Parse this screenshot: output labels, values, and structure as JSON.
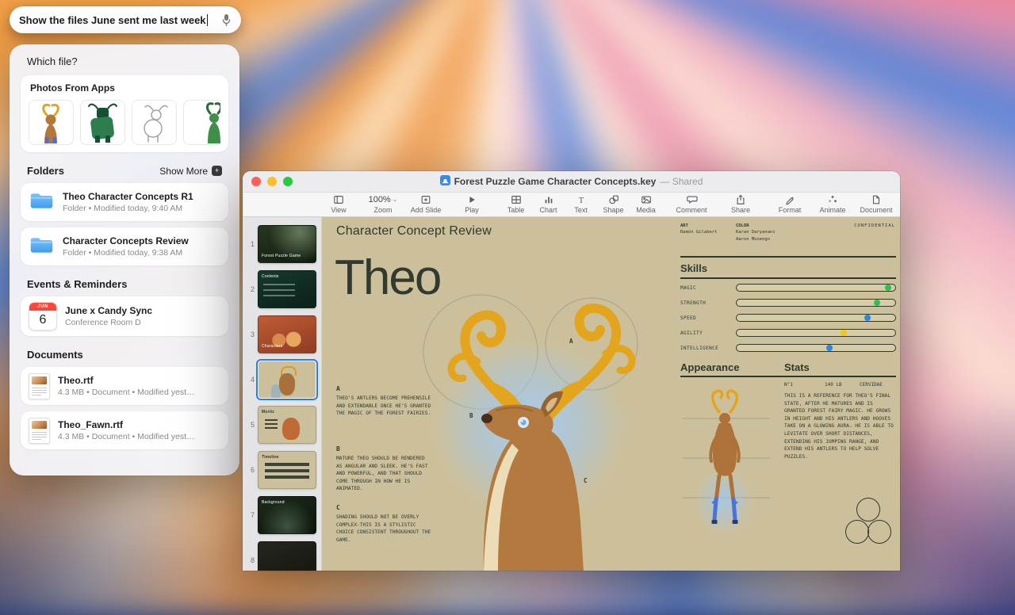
{
  "spotlight": {
    "query": "Show the files June sent me last week"
  },
  "panel": {
    "title": "Which file?",
    "photos": {
      "label": "Photos From Apps",
      "thumbs": [
        "deer-illustration-thumb",
        "green-character-thumb",
        "deer-sketch-thumb",
        "green-deer-thumb"
      ]
    },
    "folders": {
      "label": "Folders",
      "show_more": "Show More",
      "items": [
        {
          "title": "Theo Character Concepts R1",
          "subtitle": "Folder • Modified today, 9:40 AM"
        },
        {
          "title": "Character Concepts Review",
          "subtitle": "Folder • Modified today, 9:38 AM"
        }
      ]
    },
    "events": {
      "label": "Events & Reminders",
      "items": [
        {
          "month": "JUN",
          "day": "6",
          "title": "June x Candy Sync",
          "subtitle": "Conference Room D"
        }
      ]
    },
    "documents": {
      "label": "Documents",
      "items": [
        {
          "title": "Theo.rtf",
          "subtitle": "4.3 MB • Document • Modified yest…"
        },
        {
          "title": "Theo_Fawn.rtf",
          "subtitle": "4.3 MB • Document • Modified yest…"
        }
      ]
    }
  },
  "keynote": {
    "title": "Forest Puzzle Game Character Concepts.key",
    "shared": "— Shared",
    "toolbar": {
      "items": [
        {
          "label": "View"
        },
        {
          "label": "Zoom",
          "value": "100%"
        },
        {
          "label": "Add Slide"
        },
        {
          "label": "Play"
        },
        {
          "label": "Table"
        },
        {
          "label": "Chart"
        },
        {
          "label": "Text"
        },
        {
          "label": "Shape"
        },
        {
          "label": "Media"
        },
        {
          "label": "Comment"
        },
        {
          "label": "Share"
        },
        {
          "label": "Format"
        },
        {
          "label": "Animate"
        },
        {
          "label": "Document"
        }
      ]
    },
    "slides": [
      {
        "num": "1",
        "label": "Forest Puzzle Game"
      },
      {
        "num": "2",
        "label": "Contents"
      },
      {
        "num": "3",
        "label": "Characters"
      },
      {
        "num": "4",
        "label": ""
      },
      {
        "num": "5",
        "label": "Moritz"
      },
      {
        "num": "6",
        "label": "Timeline"
      },
      {
        "num": "7",
        "label": "Background"
      },
      {
        "num": "8",
        "label": ""
      }
    ],
    "slide": {
      "header": "Character Concept Review",
      "title": "Theo",
      "credits": {
        "art_label": "ART",
        "art_name": "Ramón Gilabert",
        "color_label": "COLOR",
        "color_names": [
          "Karan Daryanani",
          "Aaron Musengo"
        ],
        "confidential": "CONFIDENTIAL"
      },
      "skills": {
        "label": "Skills",
        "items": [
          {
            "name": "MAGIC",
            "value": 96,
            "color": "#2fbf4f"
          },
          {
            "name": "STRENGTH",
            "value": 89,
            "color": "#2fbf4f"
          },
          {
            "name": "SPEED",
            "value": 83,
            "color": "#2f86e0"
          },
          {
            "name": "AGILITY",
            "value": 68,
            "color": "#f5c518"
          },
          {
            "name": "INTELLIGENCE",
            "value": 59,
            "color": "#2f86e0"
          }
        ]
      },
      "appearance_label": "Appearance",
      "stats": {
        "label": "Stats",
        "values": [
          "N°1",
          "140 LB",
          "CERVIDAE"
        ],
        "description": "THIS IS A REFERENCE FOR THEO'S FINAL STATE, AFTER HE MATURES AND IS GRANTED FOREST FAIRY MAGIC. HE GROWS IN HEIGHT AND HIS ANTLERS AND HOOVES TAKE ON A GLOWING AURA. HE IS ABLE TO LEVITATE OVER SHORT DISTANCES, EXTENDING HIS JUMPING RANGE, AND EXTEND HIS ANTLERS TO HELP SOLVE PUZZLES."
      },
      "notes": [
        {
          "key": "A",
          "text": "THEO'S ANTLERS BECOME PREHENSILE AND EXTENDABLE ONCE HE'S GRANTED THE MAGIC OF THE FOREST FAIRIES."
        },
        {
          "key": "B",
          "text": "MATURE THEO SHOULD BE RENDERED AS ANGULAR AND SLEEK. HE'S FAST AND POWERFUL, AND THAT SHOULD COME THROUGH IN HOW HE IS ANIMATED."
        },
        {
          "key": "C",
          "text": "SHADING SHOULD NOT BE OVERLY COMPLEX-THIS IS A STYLISTIC CHOICE CONSISTENT THROUGHOUT THE GAME."
        }
      ]
    }
  }
}
